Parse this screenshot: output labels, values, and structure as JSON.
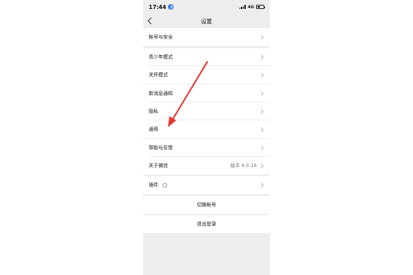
{
  "status": {
    "time": "17:44",
    "network": "4G"
  },
  "navbar": {
    "title": "设置"
  },
  "groups": {
    "account": {
      "label": "帐号与安全"
    },
    "youth": {
      "label": "青少年模式"
    },
    "care": {
      "label": "关怀模式"
    },
    "notify": {
      "label": "新消息通知"
    },
    "privacy": {
      "label": "隐私"
    },
    "general": {
      "label": "通用"
    },
    "feedback": {
      "label": "帮助与反馈"
    },
    "about": {
      "label": "关于微信",
      "value": "版本 8.0.16"
    },
    "plugins": {
      "label": "插件"
    },
    "switch_account": {
      "label": "切换帐号"
    },
    "logout": {
      "label": "退出登录"
    }
  },
  "annotation": {
    "arrow_color": "#e53935"
  },
  "colors": {
    "background": "#ededed",
    "row": "#ffffff",
    "accent": "#2f7be6"
  },
  "icons": [
    "location-icon",
    "signal-icon",
    "battery-icon",
    "back-arrow-icon",
    "chevron-right-icon",
    "plugin-icon"
  ]
}
